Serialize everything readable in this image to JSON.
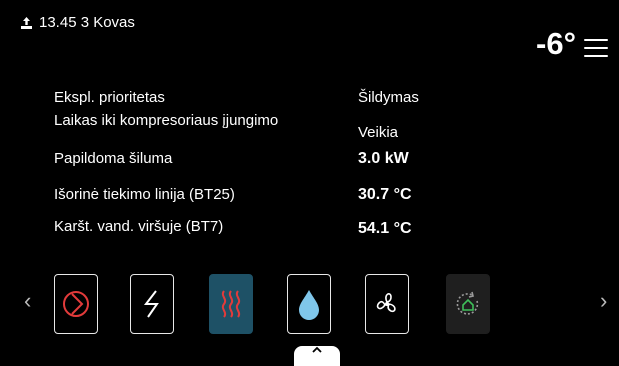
{
  "status_bar": {
    "datetime": "13.45 3 Kovas",
    "outdoor_temp": "-6°"
  },
  "info": {
    "rows": [
      {
        "label": "Ekspl. prioritetas",
        "value": "Šildymas"
      },
      {
        "label": "Laikas iki kompresoriaus įjungimo",
        "value": "Veikia"
      },
      {
        "label": "Papildoma šiluma",
        "value": "3.0 kW"
      },
      {
        "label": "Išorinė tiekimo linija (BT25)",
        "value": "30.7 °C"
      },
      {
        "label": "Karšt. vand. viršuje (BT7)",
        "value": "54.1 °C"
      }
    ]
  },
  "nav": {
    "left_arrow": "‹",
    "right_arrow": "›",
    "icons": [
      {
        "name": "compressor-icon",
        "color": "#e23b3b"
      },
      {
        "name": "electric-heater-icon",
        "color": "#ffffff"
      },
      {
        "name": "heating-icon",
        "color": "#e23b3b",
        "active": true
      },
      {
        "name": "hot-water-icon",
        "color": "#7fc6ea"
      },
      {
        "name": "fan-icon",
        "color": "#ffffff"
      },
      {
        "name": "smart-home-icon",
        "color": "#3fbf5a",
        "dim": true
      }
    ],
    "home_tab_icon": "chevron-up-icon"
  },
  "colors": {
    "background": "#000000",
    "active_tile": "#1e5166",
    "accent_red": "#e23b3b",
    "water_blue": "#7fc6ea",
    "smart_green": "#3fbf5a"
  }
}
